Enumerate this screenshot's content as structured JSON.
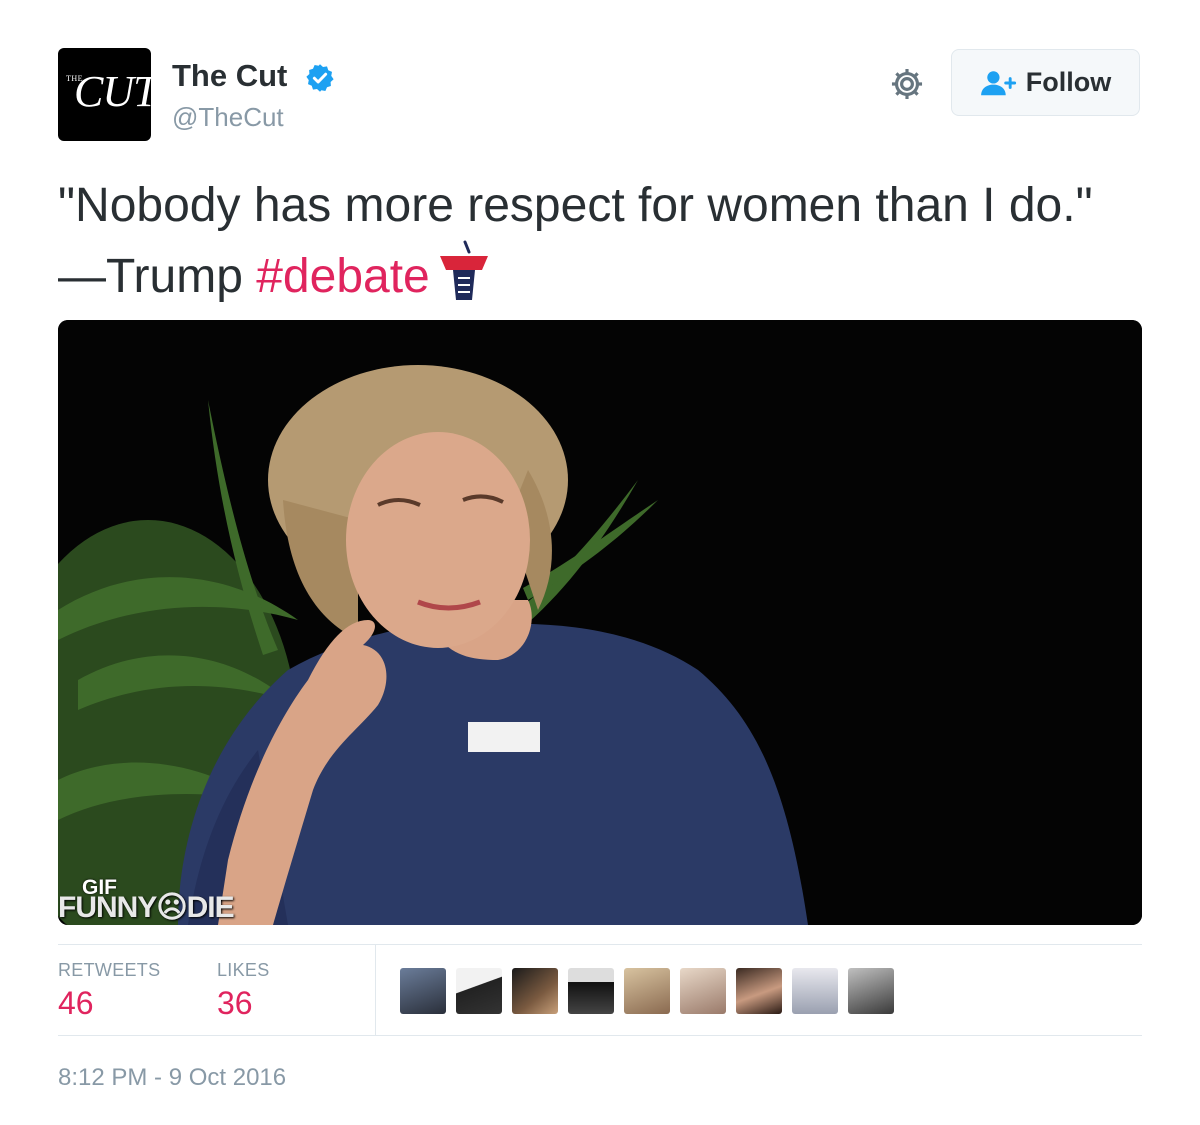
{
  "author": {
    "display_name": "The Cut",
    "handle": "@TheCut",
    "avatar_logo_small": "THE",
    "avatar_logo_main": "CUT",
    "verified": true
  },
  "follow_button": {
    "label": "Follow",
    "icon": "follow-user-icon"
  },
  "settings_icon": "gear-icon",
  "tweet": {
    "text_before": "\"Nobody has more respect for women than I do.\" —Trump ",
    "hashtag": "#debate",
    "emoji": "podium-emoji"
  },
  "media": {
    "type": "gif",
    "badge": "GIF",
    "watermark": "FUNNY☹DIE"
  },
  "stats": {
    "retweets_label": "RETWEETS",
    "retweets_value": "46",
    "likes_label": "LIKES",
    "likes_value": "36"
  },
  "likers_count_shown": 9,
  "timestamp": "8:12 PM - 9 Oct 2016",
  "colors": {
    "hashtag": "#e0245e",
    "stat_value": "#e0245e",
    "muted": "#8899a6",
    "verified": "#1da1f2",
    "follow_icon": "#1da1f2"
  }
}
